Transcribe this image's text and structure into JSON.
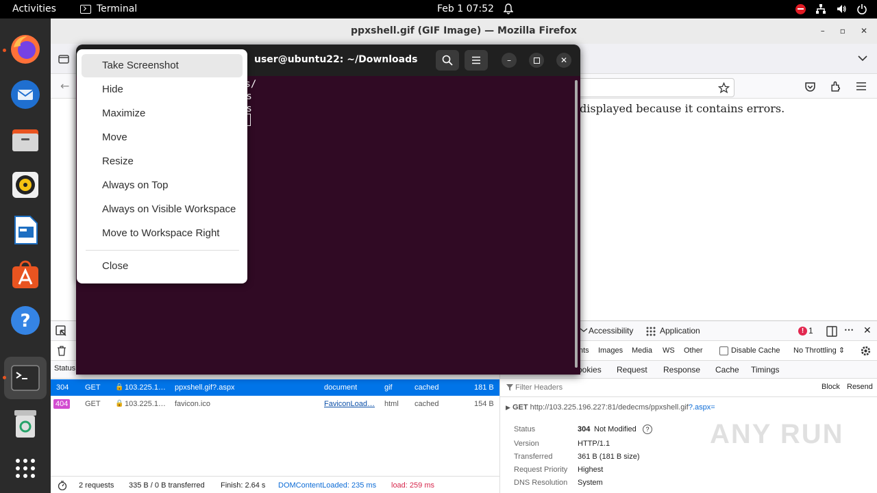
{
  "topbar": {
    "activities": "Activities",
    "app_name": "Terminal",
    "clock": "Feb 1  07:52"
  },
  "dock": {
    "items": [
      "firefox-icon",
      "thunderbird-icon",
      "files-icon",
      "rhythmbox-icon",
      "writer-icon",
      "app-center-icon",
      "help-icon",
      "terminal-icon",
      "trash-icon",
      "app-grid-icon"
    ]
  },
  "firefox": {
    "title": "ppxshell.gif (GIF Image) — Mozilla Firefox",
    "page_message": "displayed because it contains errors."
  },
  "devtools": {
    "tabs": {
      "accessibility": "Accessibility",
      "application": "Application",
      "error_count": "1"
    },
    "toolbar": {
      "filters": [
        "nts",
        "Images",
        "Media",
        "WS",
        "Other"
      ],
      "disable_cache": "Disable Cache",
      "throttling": "No Throttling ⇕"
    },
    "header_status": "Status",
    "requests": [
      {
        "status": "304",
        "method": "GET",
        "domain": "103.225.1…",
        "file": "ppxshell.gif?.aspx",
        "initiator": "document",
        "type": "gif",
        "transferred": "cached",
        "size": "181 B"
      },
      {
        "status": "404",
        "method": "GET",
        "domain": "103.225.1…",
        "file": "favicon.ico",
        "initiator": "FaviconLoad…",
        "type": "html",
        "transferred": "cached",
        "size": "154 B"
      }
    ],
    "side_tabs": [
      "ookies",
      "Request",
      "Response",
      "Cache",
      "Timings"
    ],
    "filter_placeholder": "Filter Headers",
    "block": "Block",
    "resend": "Resend",
    "get_method": "GET",
    "get_url": "http://103.225.196.227:81/dedecms/ppxshell.gif",
    "get_query": "?.aspx=",
    "headers": [
      {
        "k": "Status",
        "v": "304",
        "v2": "Not Modified"
      },
      {
        "k": "Version",
        "v": "HTTP/1.1"
      },
      {
        "k": "Transferred",
        "v": "361 B (181 B size)"
      },
      {
        "k": "Request Priority",
        "v": "Highest"
      },
      {
        "k": "DNS Resolution",
        "v": "System"
      }
    ],
    "statusbar": {
      "requests": "2 requests",
      "transferred": "335 B / 0 B transferred",
      "finish": "Finish: 2.64 s",
      "domcontent": "DOMContentLoaded: 235 ms",
      "load": "load: 259 ms"
    }
  },
  "terminal": {
    "title": "user@ubuntu22: ~/Downloads",
    "lines": [
      "ds/",
      "ls",
      "ls"
    ]
  },
  "context_menu": {
    "items": [
      "Take Screenshot",
      "Hide",
      "Maximize",
      "Move",
      "Resize",
      "Always on Top",
      "Always on Visible Workspace",
      "Move to Workspace Right"
    ],
    "close": "Close"
  },
  "watermark": "ANY RUN"
}
